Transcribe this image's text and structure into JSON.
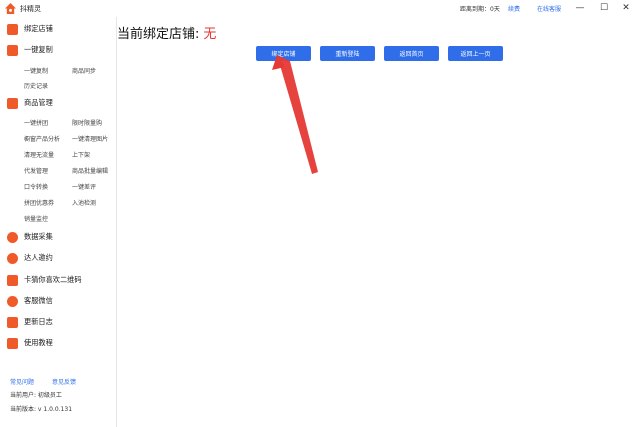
{
  "titlebar": {
    "app_title": "抖精灵",
    "expire_label": "距离到期：0天",
    "renew_label": "续费",
    "support_label": "在线客服",
    "minimize": "—",
    "maximize": "☐",
    "close": "✕"
  },
  "sidebar": {
    "sections": [
      {
        "label": "绑定店铺",
        "icon": "store-icon",
        "color": "#f05a28"
      },
      {
        "label": "一键复制",
        "icon": "copy-icon",
        "color": "#f05a28"
      },
      {
        "label": "商品管理",
        "icon": "grid-icon",
        "color": "#f05a28"
      },
      {
        "label": "数据采集",
        "icon": "collect-icon",
        "color": "#f05a28"
      },
      {
        "label": "达人邀约",
        "icon": "chat-icon",
        "color": "#f05a28"
      },
      {
        "label": "卡猜你喜欢二维码",
        "icon": "heart-icon",
        "color": "#f05a28"
      },
      {
        "label": "客服微信",
        "icon": "wechat-icon",
        "color": "#f05a28"
      },
      {
        "label": "更新日志",
        "icon": "log-icon",
        "color": "#f05a28"
      },
      {
        "label": "使用教程",
        "icon": "book-icon",
        "color": "#f05a28"
      }
    ],
    "copy_subs": [
      "一键复制",
      "商品同步",
      "历史记录"
    ],
    "manage_subs": [
      "一键拼团",
      "限时限量购",
      "橱窗产品分析",
      "一键清理图片",
      "清理无流量",
      "上下架",
      "代发管理",
      "商品批量编辑",
      "口令转换",
      "一键差评",
      "拼团优惠券",
      "入池检测",
      "销量监控"
    ],
    "footer": {
      "faq": "常见问题",
      "feedback": "意见反馈",
      "user": "当前用户: 初级员工",
      "version": "当前版本: v 1.0.0.131"
    }
  },
  "main": {
    "title_label": "当前绑定店铺:",
    "title_value": "无",
    "buttons": [
      "绑定店铺",
      "重新登陆",
      "返回首页",
      "返回上一页"
    ]
  },
  "colors": {
    "accent": "#2f6ee8",
    "brand": "#f05a28",
    "alert": "#e53935"
  }
}
